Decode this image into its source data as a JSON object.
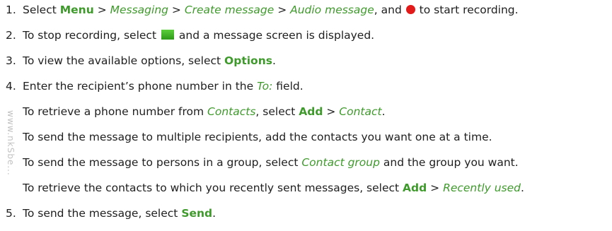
{
  "steps": [
    {
      "number": "1.",
      "parts": [
        "Select ",
        "Menu",
        " > ",
        "Messaging",
        " > ",
        "Create message",
        " > ",
        "Audio message",
        ", and ",
        " to start recording."
      ]
    },
    {
      "number": "2.",
      "parts": [
        "To stop recording, select ",
        " and a message screen is displayed."
      ]
    },
    {
      "number": "3.",
      "parts": [
        "To view the available options, select ",
        "Options",
        "."
      ]
    },
    {
      "number": "4.",
      "parts": [
        "Enter the recipient’s phone number in the ",
        "To:",
        " field."
      ]
    },
    {
      "number": "5.",
      "parts": [
        "To send the message, select ",
        "Send",
        "."
      ]
    }
  ],
  "substeps": [
    {
      "parts": [
        "To retrieve a phone number from ",
        "Contacts",
        ", select ",
        "Add",
        " > ",
        "Contact",
        "."
      ]
    },
    {
      "parts": [
        "To send the message to multiple recipients, add the contacts you want one at a time."
      ]
    },
    {
      "parts": [
        "To send the message to persons in a group, select ",
        "Contact group",
        " and the group you want."
      ]
    },
    {
      "parts": [
        "To retrieve the contacts to which you recently sent messages, select ",
        "Add",
        " > ",
        "Recently used",
        "."
      ]
    }
  ],
  "icons": {
    "record": "red-record-dot-icon",
    "stop": "green-stop-square-icon"
  },
  "colors": {
    "accent_green": "#3f9a2c",
    "record_red": "#e21a1a",
    "stop_green": "#3fb422",
    "text": "#202020",
    "watermark": "#b8b8b8"
  },
  "watermark_text": "www.nkSbe..."
}
